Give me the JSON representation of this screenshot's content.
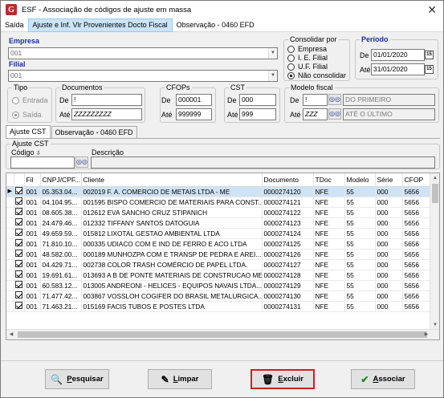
{
  "window": {
    "title": "ESF - Associação de códigos de ajuste em massa",
    "app_icon_letter": "G",
    "close_glyph": "✕"
  },
  "menu": {
    "items": [
      "Saída",
      "Ajuste e Inf. Vlr Provenientes Docto Fiscal",
      "Observação - 0460 EFD"
    ],
    "active_index": 1
  },
  "empresa": {
    "label": "Empresa",
    "value": "001"
  },
  "filial": {
    "label": "Filial",
    "value": "001"
  },
  "consolidar": {
    "label": "Consolidar por",
    "options": [
      "Empresa",
      "I. E. Filial",
      "U.F. Filial",
      "Não consolidar"
    ],
    "selected_index": 3
  },
  "periodo": {
    "label": "Período",
    "de_label": "De",
    "de_value": "01/01/2020",
    "ate_label": "Até",
    "ate_value": "31/01/2020",
    "cal_glyph": "15"
  },
  "tipo": {
    "label": "Tipo",
    "options": [
      "Entrada",
      "Saída"
    ],
    "selected_index": 1
  },
  "documentos": {
    "label": "Documentos",
    "de_label": "De",
    "de_value": "!",
    "ate_label": "Até",
    "ate_value": "ZZZZZZZZZ"
  },
  "cfops": {
    "label": "CFOPs",
    "de_label": "De",
    "de_value": "000001",
    "ate_label": "Até",
    "ate_value": "999999"
  },
  "cst": {
    "label": "CST",
    "de_label": "De",
    "de_value": "000",
    "ate_label": "Até",
    "ate_value": "999"
  },
  "modelo_fiscal": {
    "label": "Modelo fiscal",
    "de_label": "De",
    "de_value": "!",
    "de_desc": "DO PRIMEIRO",
    "ate_label": "Até",
    "ate_value": "ZZZ",
    "ate_desc": "ATÉ O ÚLTIMO"
  },
  "tabs": {
    "items": [
      "Ajuste CST",
      "Observação - 0460 EFD"
    ],
    "active_index": 0
  },
  "ajuste_cst": {
    "label": "Ajuste CST",
    "codigo_label": "Código",
    "codigo_value": "",
    "descricao_label": "Descrição",
    "descricao_value": ""
  },
  "grid": {
    "columns": [
      "",
      "",
      "Fil",
      "CNPJ/CPF...",
      "Cliente",
      "Documento",
      "TDoc",
      "Modelo",
      "Série",
      "CFOP"
    ],
    "rows": [
      {
        "fil": "001",
        "cnpj": "05.353.04...",
        "cliente": "002019 F. A. COMERCIO DE METAIS LTDA - ME",
        "documento": "0000274120",
        "tdoc": "NFE",
        "modelo": "55",
        "serie": "000",
        "cfop": "5656"
      },
      {
        "fil": "001",
        "cnpj": "04.104.95...",
        "cliente": "001595 BISPO COMERCIO DE MATERIAIS PARA CONST...",
        "documento": "0000274121",
        "tdoc": "NFE",
        "modelo": "55",
        "serie": "000",
        "cfop": "5656"
      },
      {
        "fil": "001",
        "cnpj": "08.605.38...",
        "cliente": "012612 EVA SANCHO CRUZ STIPANICH",
        "documento": "0000274122",
        "tdoc": "NFE",
        "modelo": "55",
        "serie": "000",
        "cfop": "5656"
      },
      {
        "fil": "001",
        "cnpj": "24.479.46...",
        "cliente": "012332 TIFFANY SANTOS DATOGUIA",
        "documento": "0000274123",
        "tdoc": "NFE",
        "modelo": "55",
        "serie": "000",
        "cfop": "5656"
      },
      {
        "fil": "001",
        "cnpj": "49.659.59...",
        "cliente": "015812 LIXOTAL GESTAO AMBIENTAL LTDA",
        "documento": "0000274124",
        "tdoc": "NFE",
        "modelo": "55",
        "serie": "000",
        "cfop": "5656"
      },
      {
        "fil": "001",
        "cnpj": "71.810.10...",
        "cliente": "000335 UDIACO COM E IND DE FERRO E ACO LTDA",
        "documento": "0000274125",
        "tdoc": "NFE",
        "modelo": "55",
        "serie": "000",
        "cfop": "5656"
      },
      {
        "fil": "001",
        "cnpj": "48.582.00...",
        "cliente": "000189 MUNHOZPA COM E TRANSP DE PEDRA E AREI...",
        "documento": "0000274126",
        "tdoc": "NFE",
        "modelo": "55",
        "serie": "000",
        "cfop": "5656"
      },
      {
        "fil": "001",
        "cnpj": "04.429.71...",
        "cliente": "002738 COLOR TRASH COMÉRCIO DE PAPEL LTDA.",
        "documento": "0000274127",
        "tdoc": "NFE",
        "modelo": "55",
        "serie": "000",
        "cfop": "5656"
      },
      {
        "fil": "001",
        "cnpj": "19.691.61...",
        "cliente": "013693 A B DE PONTE MATERIAIS DE CONSTRUCAO ME",
        "documento": "0000274128",
        "tdoc": "NFE",
        "modelo": "55",
        "serie": "000",
        "cfop": "5656"
      },
      {
        "fil": "001",
        "cnpj": "60.583.12...",
        "cliente": "013005 ANDREONI - HELICES - EQUIPOS NAVAIS LTDA...",
        "documento": "0000274129",
        "tdoc": "NFE",
        "modelo": "55",
        "serie": "000",
        "cfop": "5656"
      },
      {
        "fil": "001",
        "cnpj": "71.477.42...",
        "cliente": "003867 VOSSLOH COGIFER DO BRASIL METALURGICA...",
        "documento": "0000274130",
        "tdoc": "NFE",
        "modelo": "55",
        "serie": "000",
        "cfop": "5656"
      },
      {
        "fil": "001",
        "cnpj": "71.463.21...",
        "cliente": "015169 FACIS TUBOS E POSTES LTDA",
        "documento": "0000274131",
        "tdoc": "NFE",
        "modelo": "55",
        "serie": "000",
        "cfop": "5656"
      }
    ],
    "selected_row": 0
  },
  "buttons": {
    "pesquisar": {
      "first": "P",
      "rest": "esquisar"
    },
    "limpar": {
      "first": "L",
      "rest": "impar"
    },
    "excluir": {
      "first": "E",
      "rest": "xcluir"
    },
    "associar": {
      "first": "A",
      "rest": "ssociar"
    }
  }
}
